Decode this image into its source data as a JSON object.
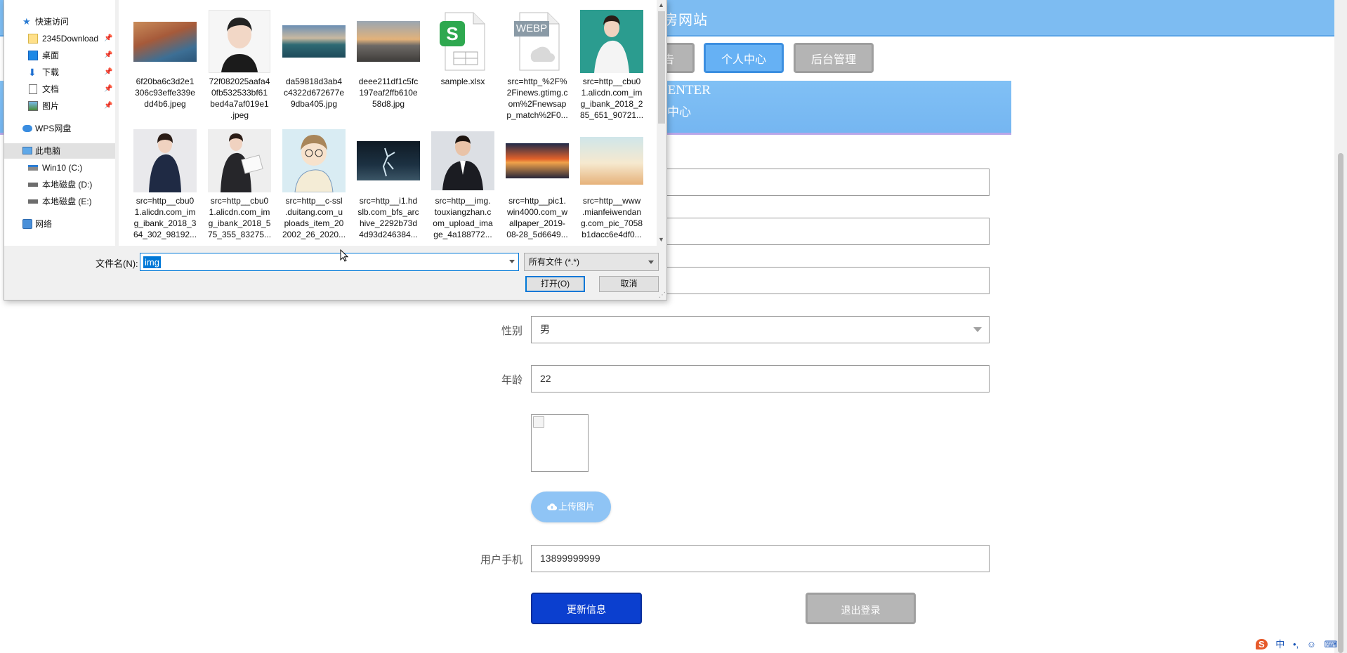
{
  "page": {
    "site_title": "房网站",
    "nav": [
      {
        "label": "告"
      },
      {
        "label": "个人中心"
      },
      {
        "label": "后台管理"
      }
    ],
    "banner": {
      "title_en": "CENTER",
      "title_cn": "中心"
    }
  },
  "form": {
    "gender": {
      "label": "性别",
      "value": "男"
    },
    "age": {
      "label": "年龄",
      "value": "22"
    },
    "upload_button": "上传图片",
    "phone": {
      "label": "用户手机",
      "value": "13899999999"
    },
    "update_button": "更新信息",
    "logout_button": "退出登录"
  },
  "tray": {
    "ime": "中"
  },
  "dialog": {
    "nav": [
      {
        "label": "快速访问",
        "icon": "star-icon"
      },
      {
        "label": "2345Download",
        "icon": "folder-icon",
        "pinned": true
      },
      {
        "label": "桌面",
        "icon": "desktop-icon",
        "pinned": true
      },
      {
        "label": "下载",
        "icon": "download-icon",
        "pinned": true
      },
      {
        "label": "文档",
        "icon": "document-icon",
        "pinned": true
      },
      {
        "label": "图片",
        "icon": "pictures-icon",
        "pinned": true
      },
      {
        "label": "WPS网盘",
        "icon": "cloud-icon"
      },
      {
        "label": "此电脑",
        "icon": "computer-icon",
        "selected": true
      },
      {
        "label": "Win10 (C:)",
        "icon": "windows-drive-icon"
      },
      {
        "label": "本地磁盘 (D:)",
        "icon": "drive-icon"
      },
      {
        "label": "本地磁盘 (E:)",
        "icon": "drive-icon"
      },
      {
        "label": "网络",
        "icon": "network-icon"
      }
    ],
    "files": [
      {
        "name": "6f20ba6c3d2e1306c93effe339edd4b6.jpeg",
        "lines": [
          "6f20ba6c3d2e1",
          "306c93effe339e",
          "dd4b6.jpeg"
        ],
        "thumb": "cliff-town"
      },
      {
        "name": "72f082025aafa40fb532533bf61bed4a7af019e1.jpeg",
        "lines": [
          "72f082025aafa4",
          "0fb532533bf61",
          "bed4a7af019e1",
          ".jpeg"
        ],
        "thumb": "avatar"
      },
      {
        "name": "da59818d3ab4c4322d672677e9dba405.jpg",
        "lines": [
          "da59818d3ab4",
          "c4322d672677e",
          "9dba405.jpg"
        ],
        "thumb": "island"
      },
      {
        "name": "deee211df1c5fc197eaf2ffb610e58d8.jpg",
        "lines": [
          "deee211df1c5fc",
          "197eaf2ffb610e",
          "58d8.jpg"
        ],
        "thumb": "sunset-beach"
      },
      {
        "name": "sample.xlsx",
        "lines": [
          "sample.xlsx"
        ],
        "thumb": "xlsx"
      },
      {
        "name": "src=http_%2F%2Finews.gtimg.com%2Fnewsapp_match%2F0...",
        "lines": [
          "src=http_%2F%",
          "2Finews.gtimg.c",
          "om%2Fnewsap",
          "p_match%2F0..."
        ],
        "thumb": "webp",
        "badge": "WEBP"
      },
      {
        "name": "src=http__cbu01.alicdn.com_img_ibank_2018_285_651_90721...",
        "lines": [
          "src=http__cbu0",
          "1.alicdn.com_im",
          "g_ibank_2018_2",
          "85_651_90721..."
        ],
        "thumb": "woman-white"
      },
      {
        "name": "src=http__cbu01.alicdn.com_img_ibank_2018_364_302_98192...",
        "lines": [
          "src=http__cbu0",
          "1.alicdn.com_im",
          "g_ibank_2018_3",
          "64_302_98192..."
        ],
        "thumb": "woman-suit"
      },
      {
        "name": "src=http__cbu01.alicdn.com_img_ibank_2018_575_355_83275...",
        "lines": [
          "src=http__cbu0",
          "1.alicdn.com_im",
          "g_ibank_2018_5",
          "75_355_83275..."
        ],
        "thumb": "woman-folder"
      },
      {
        "name": "src=http__c-ssl.duitang.com_uploads_item_202002_26_2020...",
        "lines": [
          "src=http__c-ssl",
          ".duitang.com_u",
          "ploads_item_20",
          "2002_26_2020..."
        ],
        "thumb": "cartoon"
      },
      {
        "name": "src=http__i1.hdslb.com_bfs_archive_2292b73d4d93d246384...",
        "lines": [
          "src=http__i1.hd",
          "slb.com_bfs_arc",
          "hive_2292b73d",
          "4d93d246384..."
        ],
        "thumb": "dancer"
      },
      {
        "name": "src=http__img.touxiangzhan.com_upload_image_4a188772...",
        "lines": [
          "src=http__img.",
          "touxiangzhan.c",
          "om_upload_ima",
          "ge_4a188772..."
        ],
        "thumb": "man-suit"
      },
      {
        "name": "src=http__pic1.win4000.com_wallpaper_2019-08-28_5d6649...",
        "lines": [
          "src=http__pic1.",
          "win4000.com_w",
          "allpaper_2019-",
          "08-28_5d6649..."
        ],
        "thumb": "orange-sky"
      },
      {
        "name": "src=http__www.mianfeiwendang.com_pic_7058b1dacc6e4df0...",
        "lines": [
          "src=http__www",
          ".mianfeiwendan",
          "g.com_pic_7058",
          "b1dacc6e4df0..."
        ],
        "thumb": "desert"
      }
    ],
    "filename": {
      "label": "文件名(N):",
      "value": "img"
    },
    "filter": "所有文件 (*.*)",
    "open_button": "打开(O)",
    "cancel_button": "取消"
  }
}
